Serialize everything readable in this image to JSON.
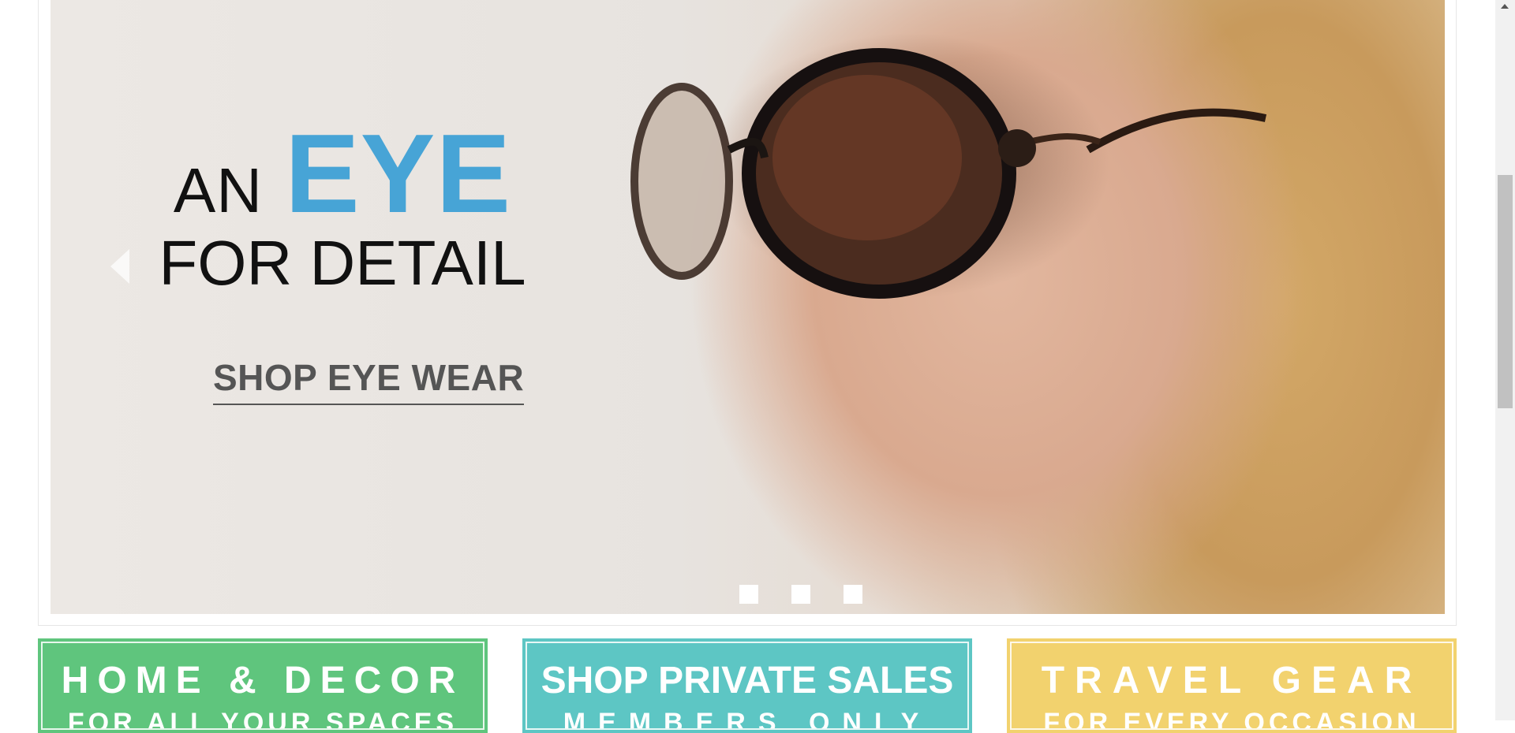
{
  "hero": {
    "headline_an": "AN",
    "headline_eye": "EYE",
    "headline_line2": "FOR DETAIL",
    "cta_label": "SHOP EYE WEAR",
    "accent_color": "#47a4d6",
    "prev_icon": "chevron-left-icon",
    "next_icon": "chevron-right-icon",
    "slides": [
      {
        "state": "default"
      },
      {
        "state": "default"
      },
      {
        "state": "default"
      }
    ]
  },
  "promos": [
    {
      "title": "HOME & DECOR",
      "subtitle": "FOR ALL YOUR SPACES",
      "color": "#5fc57d"
    },
    {
      "title": "SHOP PRIVATE SALES",
      "subtitle": "MEMBERS ONLY",
      "color": "#5dc6c4"
    },
    {
      "title": "TRAVEL GEAR",
      "subtitle": "FOR EVERY OCCASION",
      "color": "#f2d26e"
    }
  ],
  "scrollbar": {
    "up_icon": "arrow-up-icon"
  }
}
